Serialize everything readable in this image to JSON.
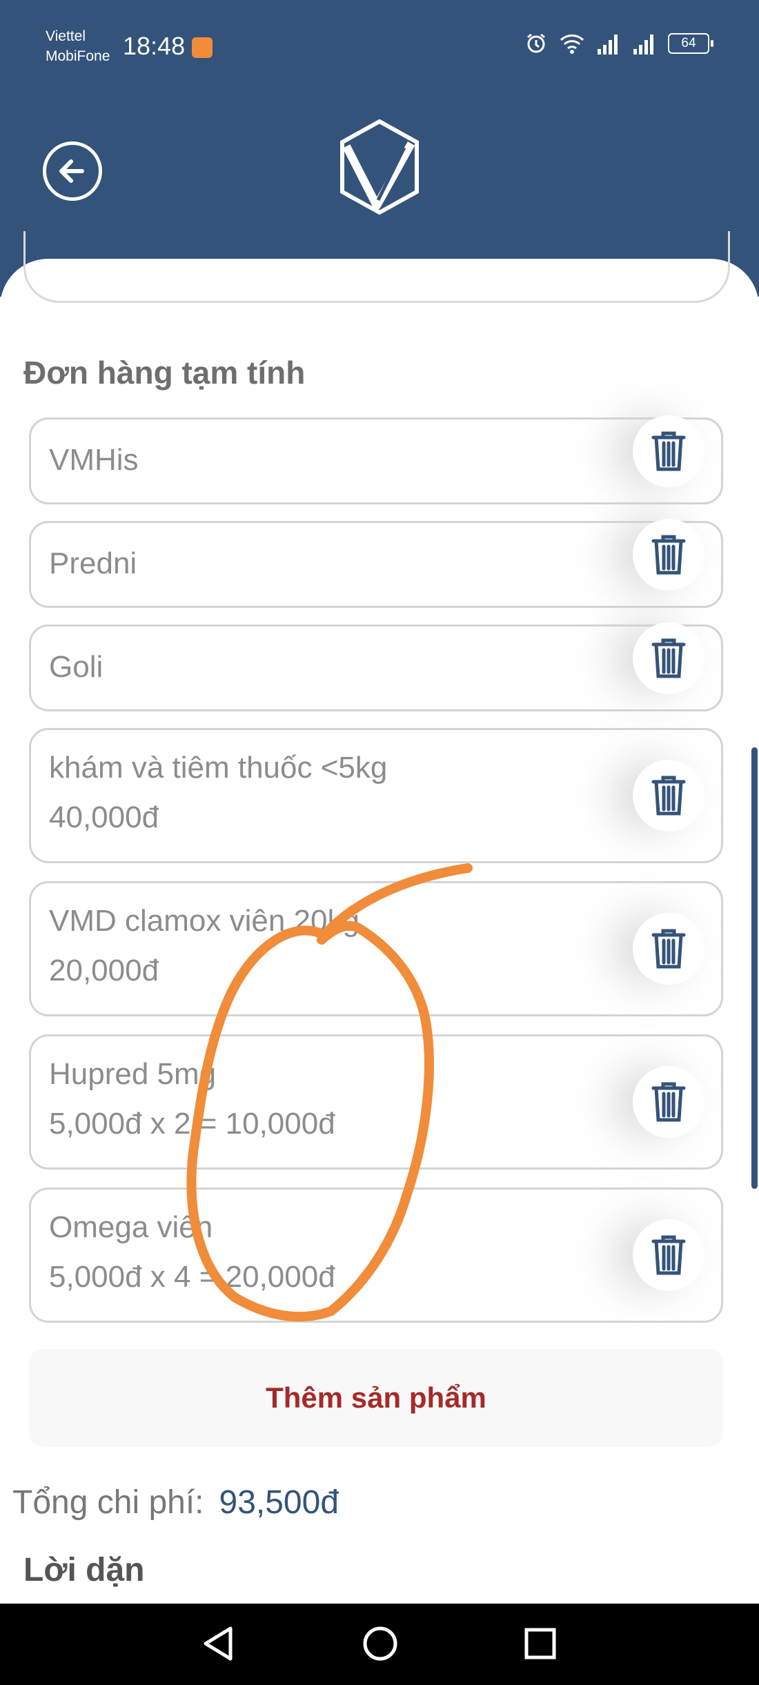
{
  "status_bar": {
    "carrier_1": "Viettel",
    "carrier_2": "MobiFone",
    "time": "18:48",
    "battery": "64",
    "icons": [
      "alarm-icon",
      "wifi-icon",
      "signal-icon",
      "signal-icon",
      "battery-icon"
    ]
  },
  "header": {
    "back_icon": "arrow-left-icon",
    "logo_icon": "vm-logo"
  },
  "order": {
    "title": "Đơn hàng tạm tính",
    "items": [
      {
        "name": "VMHis",
        "price": ""
      },
      {
        "name": "Predni",
        "price": ""
      },
      {
        "name": "Goli",
        "price": ""
      },
      {
        "name": "khám và tiêm thuốc <5kg",
        "price": "40,000đ"
      },
      {
        "name": "VMD clamox viên 20kg",
        "price": "20,000đ"
      },
      {
        "name": "Hupred 5mg",
        "price": "5,000đ x 2 = 10,000đ"
      },
      {
        "name": "Omega viên",
        "price": "5,000đ x 4 = 20,000đ"
      }
    ],
    "delete_icon": "trash-icon",
    "add_label": "Thêm sản phẩm"
  },
  "summary": {
    "total_label": "Tổng chi phí:",
    "total_value": "93,500đ",
    "notes_label": "Lời dặn"
  },
  "colors": {
    "primary": "#33537a",
    "accent_red": "#a52a2a",
    "annotation_orange": "#f08c3a"
  }
}
